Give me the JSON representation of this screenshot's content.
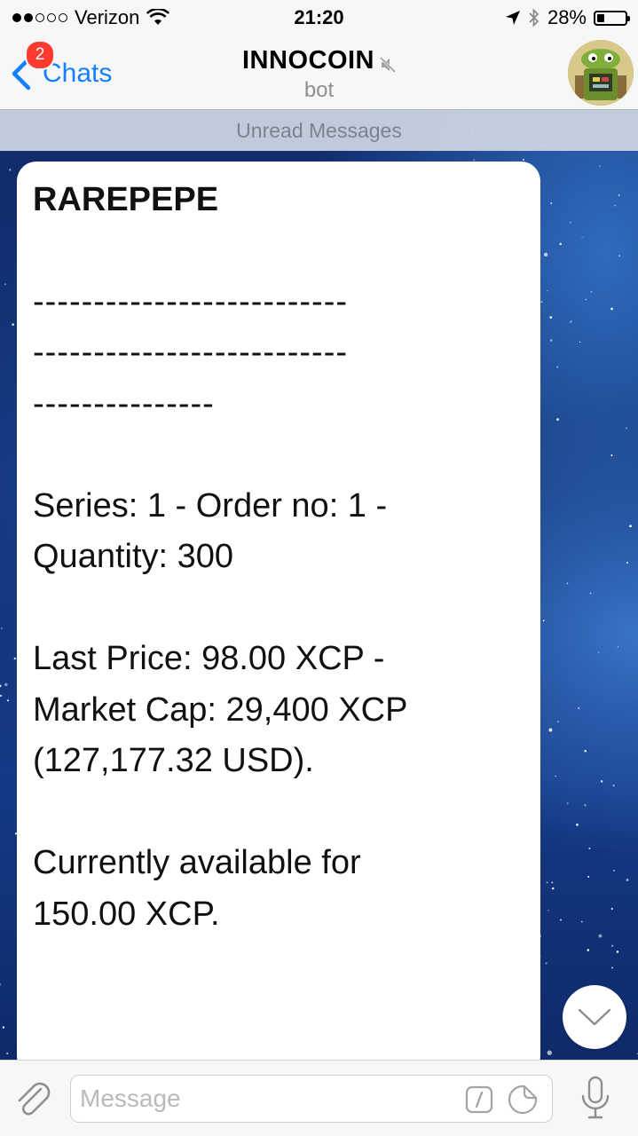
{
  "status_bar": {
    "carrier": "Verizon",
    "time": "21:20",
    "battery_percent": "28%",
    "battery_level": 0.28,
    "signal_bars_filled": 2,
    "signal_bars_total": 5,
    "icons": [
      "wifi-icon",
      "location-arrow-icon",
      "bluetooth-icon",
      "battery-icon"
    ]
  },
  "nav": {
    "back_label": "Chats",
    "unread_badge": "2",
    "title": "INNOCOIN",
    "subtitle": "bot",
    "muted": true,
    "accent_color": "#157efb",
    "badge_color": "#ff3b30"
  },
  "unread_divider": "Unread Messages",
  "message": {
    "title": "RAREPEPE",
    "lines": [
      "",
      "--------------------------",
      "--------------------------",
      "---------------",
      "",
      "Series: 1 - Order no: 1 -",
      "Quantity: 300",
      "",
      "Last Price: 98.00 XCP -",
      "Market Cap: 29,400 XCP",
      "(127,177.32 USD).",
      "",
      "Currently available for",
      "150.00 XCP.",
      "",
      "",
      "--------------------------"
    ]
  },
  "composer": {
    "placeholder": "Message",
    "value": ""
  }
}
